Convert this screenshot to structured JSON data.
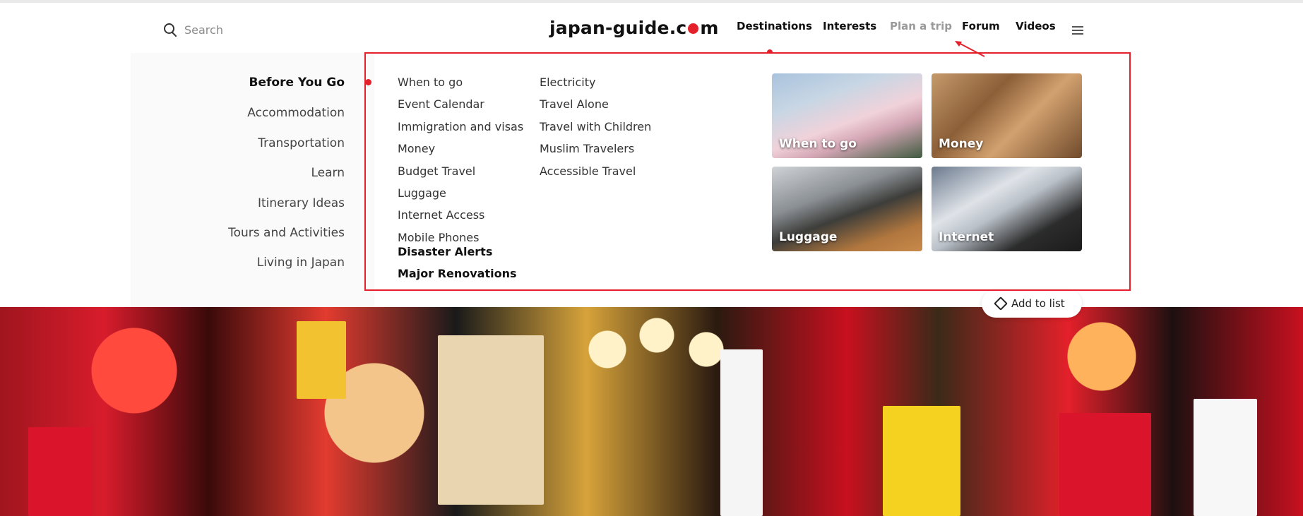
{
  "header": {
    "search_label": "Search",
    "logo_before": "japan-guide.c",
    "logo_after": "m",
    "nav": [
      {
        "label": "Destinations"
      },
      {
        "label": "Interests"
      },
      {
        "label": "Plan a trip"
      },
      {
        "label": "Forum"
      },
      {
        "label": "Videos"
      }
    ]
  },
  "sidebar": {
    "items": [
      {
        "label": "Before You Go"
      },
      {
        "label": "Accommodation"
      },
      {
        "label": "Transportation"
      },
      {
        "label": "Learn"
      },
      {
        "label": "Itinerary Ideas"
      },
      {
        "label": "Tours and Activities"
      },
      {
        "label": "Living in Japan"
      }
    ]
  },
  "columns": {
    "col1": [
      {
        "label": "When to go"
      },
      {
        "label": "Event Calendar"
      },
      {
        "label": "Immigration and visas"
      },
      {
        "label": "Money"
      },
      {
        "label": "Budget Travel"
      },
      {
        "label": "Luggage"
      },
      {
        "label": "Internet Access"
      },
      {
        "label": "Mobile Phones"
      },
      {
        "label": "Disaster Alerts"
      },
      {
        "label": "Major Renovations"
      }
    ],
    "col2": [
      {
        "label": "Electricity"
      },
      {
        "label": "Travel Alone"
      },
      {
        "label": "Travel with Children"
      },
      {
        "label": "Muslim Travelers"
      },
      {
        "label": "Accessible Travel"
      }
    ]
  },
  "cards": [
    {
      "caption": "When to go"
    },
    {
      "caption": "Money"
    },
    {
      "caption": "Luggage"
    },
    {
      "caption": "Internet"
    }
  ],
  "hero": {
    "add_to_list": "Add to list"
  },
  "colors": {
    "accent": "#e4202a",
    "annotation": "#e4202a"
  }
}
